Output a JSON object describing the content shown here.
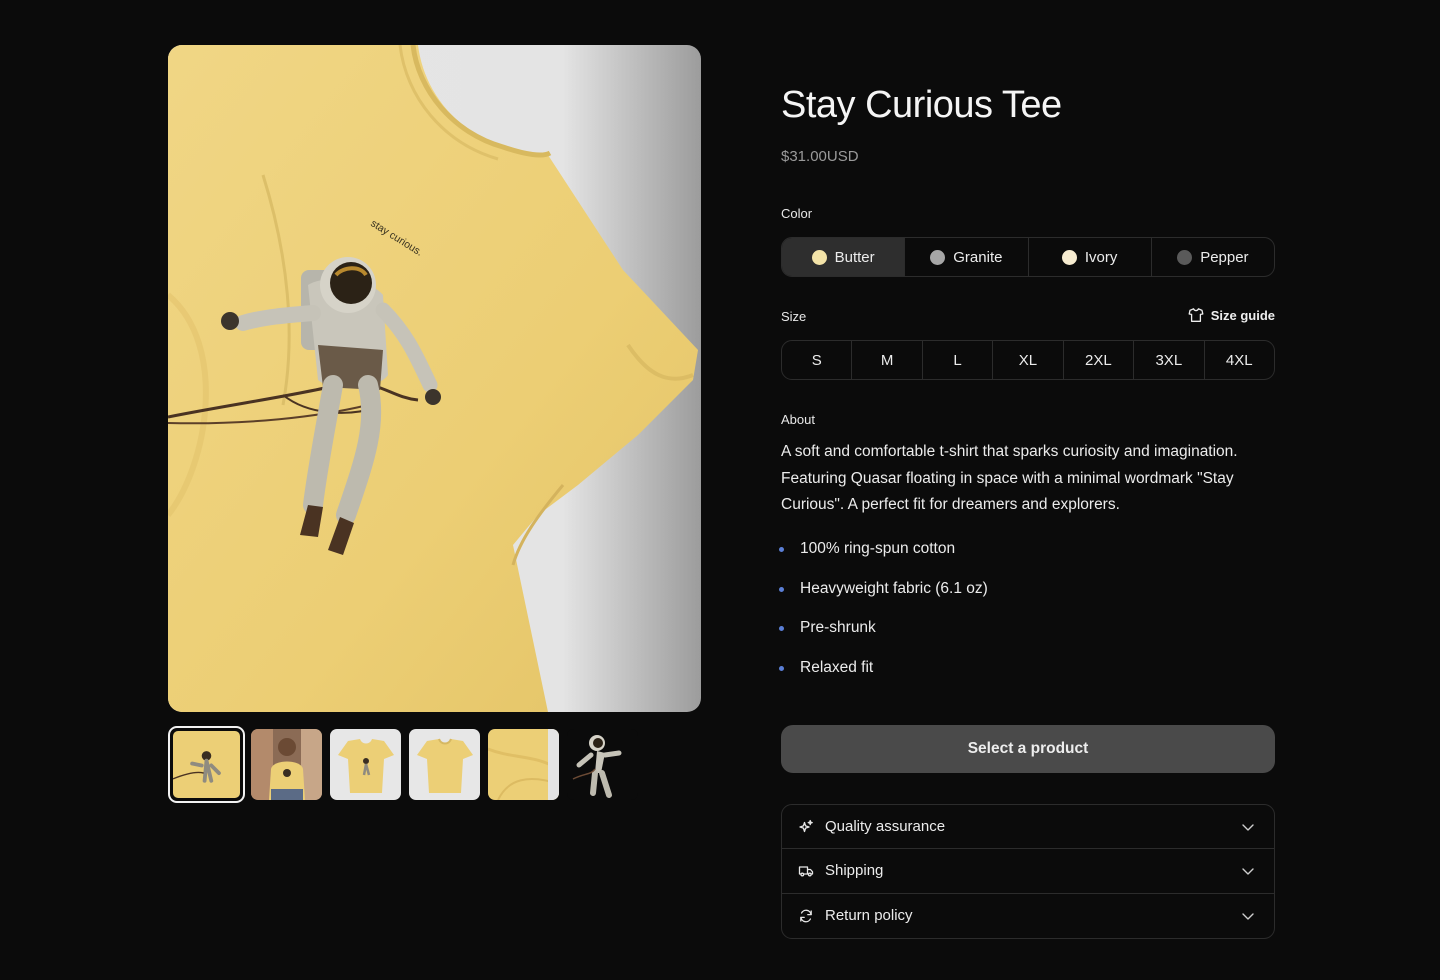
{
  "gallery": {
    "hero_shirt_text": "stay curious.",
    "thumbnails": [
      {
        "id": "thumb-1",
        "active": true
      },
      {
        "id": "thumb-2",
        "active": false
      },
      {
        "id": "thumb-3",
        "active": false
      },
      {
        "id": "thumb-4",
        "active": false
      },
      {
        "id": "thumb-5",
        "active": false
      },
      {
        "id": "thumb-6",
        "active": false
      }
    ]
  },
  "product": {
    "title": "Stay Curious Tee",
    "price": "$31.00USD"
  },
  "color": {
    "label": "Color",
    "selected": "Butter",
    "options": [
      {
        "name": "Butter",
        "swatch": "#f3e3a8"
      },
      {
        "name": "Granite",
        "swatch": "#a6a6a6"
      },
      {
        "name": "Ivory",
        "swatch": "#f7ecd0"
      },
      {
        "name": "Pepper",
        "swatch": "#5a5a5a"
      }
    ]
  },
  "size": {
    "label": "Size",
    "guide_label": "Size guide",
    "guide_icon": "tshirt-icon",
    "options": [
      "S",
      "M",
      "L",
      "XL",
      "2XL",
      "3XL",
      "4XL"
    ]
  },
  "about": {
    "label": "About",
    "description": "A soft and comfortable t-shirt that sparks curiosity and imagination. Featuring Quasar floating in space with a minimal wordmark \"Stay Curious\". A perfect fit for dreamers and explorers.",
    "bullets": [
      "100% ring-spun cotton",
      "Heavyweight fabric (6.1 oz)",
      "Pre-shrunk",
      "Relaxed fit"
    ]
  },
  "cta": {
    "label": "Select a product"
  },
  "accordion": [
    {
      "label": "Quality assurance",
      "icon": "sparkle-icon"
    },
    {
      "label": "Shipping",
      "icon": "truck-icon"
    },
    {
      "label": "Return policy",
      "icon": "refresh-icon"
    }
  ],
  "colors": {
    "background": "#0b0b0b",
    "shirt": "#efd27c",
    "cta": "#4a4a4a",
    "bullet": "#5b7fd6"
  }
}
